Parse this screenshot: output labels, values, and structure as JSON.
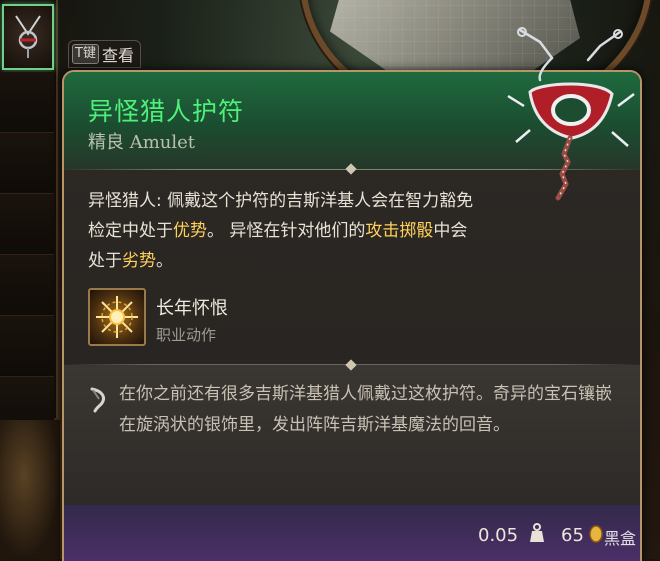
{
  "inspect_hint": {
    "key": "T键",
    "label": "查看"
  },
  "item": {
    "name": "异怪猎人护符",
    "rarity_type": "精良 Amulet",
    "rarity_color": "#4ff07a",
    "effect": {
      "name": "异怪猎人:",
      "text1": " 佩戴这个护符的吉斯洋基人会在智力豁免检定中处于",
      "kw1": "优势",
      "text2": "。 异怪在针对他们的",
      "kw2": "攻击掷骰",
      "text3": "中会处于",
      "kw3": "劣势",
      "text4": "。"
    },
    "action": {
      "name": "长年怀恨",
      "type": "职业动作",
      "icon": "radiant-burst-icon"
    },
    "lore": "在你之前还有很多吉斯洋基猎人佩戴过这枚护符。奇异的宝石镶嵌在旋涡状的银饰里，发出阵阵吉斯洋基魔法的回音。",
    "weight": "0.05",
    "price": "65",
    "watermark": "黑盒"
  },
  "colors": {
    "header_green": "#1f6a3e",
    "keyword_gold": "#ffd25a",
    "border_gold": "#b8946a",
    "footer_purple": "#4b2f68"
  }
}
